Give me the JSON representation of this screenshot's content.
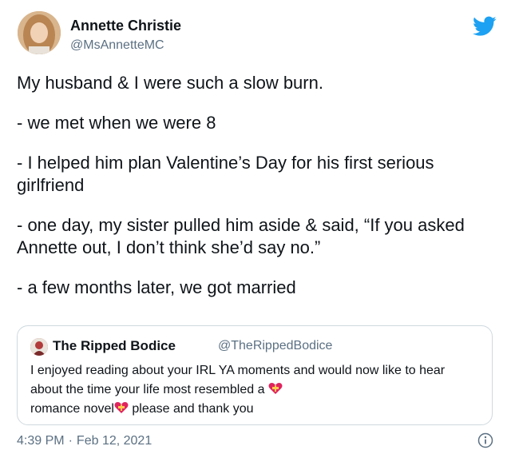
{
  "author": {
    "display_name": "Annette Christie",
    "handle": "@MsAnnetteMC",
    "avatar_icon": "user-avatar"
  },
  "brand": {
    "icon": "twitter-bird-icon",
    "color": "#1da1f2"
  },
  "tweet": {
    "lines": [
      "My husband & I were such a slow burn.",
      "- we met when we were 8",
      "- I helped him plan Valentine’s Day for his first serious girlfriend",
      "- one day, my sister pulled him aside & said, “If you asked Annette out, I don’t think she’d say no.”",
      "- a few months later, we got married"
    ]
  },
  "quoted_tweet": {
    "display_name": "The Ripped Bodice",
    "handle": "@TheRippedBodice",
    "text_part1": "I enjoyed reading about your IRL YA  moments and would now like to hear about the time your life most resembled a",
    "text_part2": "romance novel",
    "text_part3": "please and thank you",
    "emoji_icon": "heart-with-ribbon-icon"
  },
  "meta": {
    "time": "4:39 PM",
    "separator": "·",
    "date": "Feb 12, 2021",
    "info_icon": "info-icon"
  },
  "colors": {
    "text": "#0f1419",
    "secondary_text": "#5b7083",
    "border": "#cfd9de",
    "accent": "#1da1f2"
  }
}
